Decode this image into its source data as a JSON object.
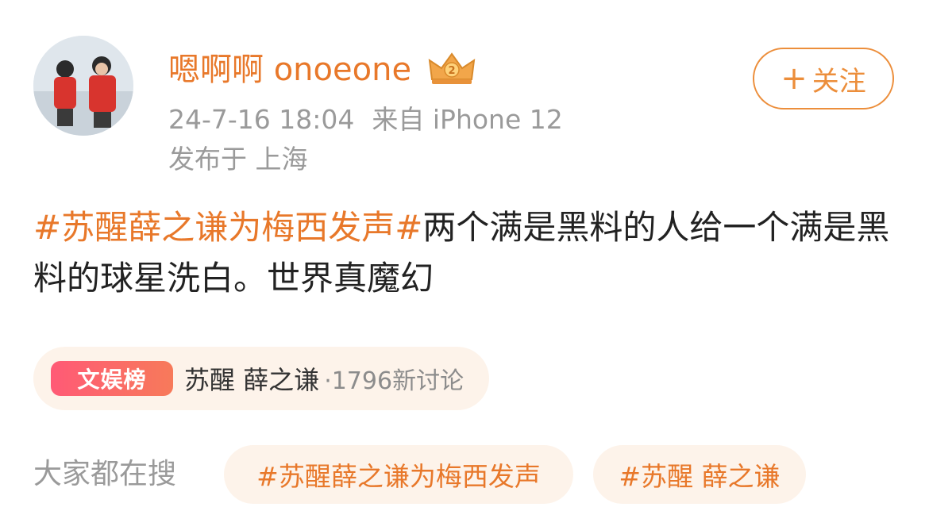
{
  "user": {
    "name": "嗯啊啊 onoeone",
    "timestamp": "24-7-16 18:04",
    "source": "来自 iPhone 12",
    "location": "发布于 上海",
    "follow_label": "关注",
    "follow_plus": "+"
  },
  "post": {
    "hashtag": "#苏醒薛之谦为梅西发声#",
    "body": "两个满是黑料的人给一个满是黑料的球星洗白。世界真魔幻"
  },
  "topic": {
    "badge": "文娱榜",
    "title": "苏醒 薛之谦",
    "count": "·1796新讨论"
  },
  "search": {
    "label": "大家都在搜",
    "chips": [
      "#苏醒薛之谦为梅西发声",
      "#苏醒 薛之谦"
    ]
  },
  "colors": {
    "accent": "#e8782a",
    "meta_gray": "#9a9a9a",
    "chip_bg": "#fdf3ea",
    "badge_gradient_start": "#ff5a76",
    "badge_gradient_end": "#f77a5a"
  }
}
